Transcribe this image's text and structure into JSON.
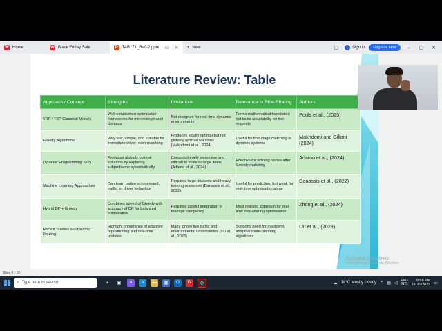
{
  "browser": {
    "tabs": [
      {
        "label": "Home"
      },
      {
        "label": "Black Friday Sale"
      },
      {
        "label": "TAB171_Rafi-2.pptx"
      }
    ],
    "new_tab": "New",
    "sign_in": "Sign in",
    "upgrade": "Upgrade Now"
  },
  "slide": {
    "title": "Literature Review: Table",
    "headers": [
      "Approach / Concept",
      "Strengths",
      "Limitations",
      "Relevance to Ride-Sharing",
      "Authors"
    ],
    "rows": [
      {
        "approach": "VRP / TSP Classical Models",
        "strengths": "Well-established optimisation frameworks for minimising travel distance",
        "limitations": "Not designed for real-time dynamic environments",
        "relevance": "Forms mathematical foundation but lacks adaptability for live requests",
        "authors": "Pouls et al., (2025)"
      },
      {
        "approach": "Greedy Algorithms",
        "strengths": "Very fast, simple, and suitable for immediate driver–rider matching",
        "limitations": "Produces locally optimal but not globally optimal solutions (Makhdomi et al., 2024)",
        "relevance": "Useful for first-stage matching in dynamic systems",
        "authors": "Makhdomi and Gillani (2024)"
      },
      {
        "approach": "Dynamic Programming (DP)",
        "strengths": "Produces globally optimal solutions by exploring subproblems systematically",
        "limitations": "Computationally expensive and difficult to scale to large fleets (Adamo et al., 2024)",
        "relevance": "Effective for refining routes after Greedy matching",
        "authors": "Adamo et al., (2024)"
      },
      {
        "approach": "Machine Learning Approaches",
        "strengths": "Can learn patterns in demand, traffic, or driver behaviour",
        "limitations": "Requires large datasets and heavy training resources (Danassis et al., 2022)",
        "relevance": "Useful for prediction, but weak for real-time optimisation alone",
        "authors": "Danassis et al., (2022)"
      },
      {
        "approach": "Hybrid DP + Greedy",
        "strengths": "Combines speed of Greedy with accuracy of DP for balanced optimisation",
        "limitations": "Requires careful integration to manage complexity",
        "relevance": "Most realistic approach for real-time ride-sharing optimisation",
        "authors": "Zhong et al., (2024)"
      },
      {
        "approach": "Recent Studies on Dynamic Routing",
        "strengths": "Highlight importance of adaptive repositioning and real-time updates",
        "limitations": "Many ignore live traffic and environmental uncertainties (Liu et al., 2023)",
        "relevance": "Supports need for intelligent, adaptive route-planning algorithms",
        "authors": "Liu et al., (2023)"
      }
    ]
  },
  "watermark": {
    "line1": "Activate Windows",
    "line2": "Go to Settings to activate Windows."
  },
  "status": {
    "slide_counter": "Slide 6 / 15"
  },
  "taskbar": {
    "search_placeholder": "Type here to search",
    "weather": "18°C  Mostly cloudy",
    "lang": "ENG",
    "lang2": "INTL",
    "time": "9:58 PM",
    "date": "11/20/2025"
  },
  "colors": {
    "header_green": "#3fae49",
    "cell_green": "#c7e9c5",
    "title_blue": "#1f3a5f"
  }
}
